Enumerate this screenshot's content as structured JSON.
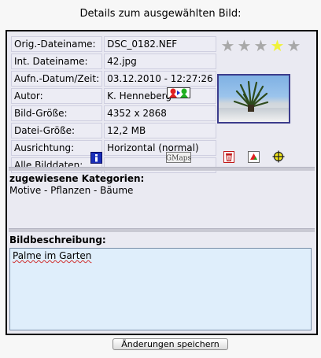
{
  "header": {
    "title": "Details zum ausgewählten Bild:"
  },
  "details": {
    "rows": [
      {
        "label": "Orig.-Dateiname:",
        "value": "DSC_0182.NEF"
      },
      {
        "label": "Int. Dateiname:",
        "value": "42.jpg"
      },
      {
        "label": "Aufn.-Datum/Zeit:",
        "value": "03.12.2010 - 12:27:26"
      },
      {
        "label": "Autor:",
        "value": "K. Henneberg"
      },
      {
        "label": "Bild-Größe:",
        "value": "4352 x 2868"
      },
      {
        "label": "Datei-Größe:",
        "value": "12,2 MB"
      },
      {
        "label": "Ausrichtung:",
        "value": "Horizontal (normal)"
      },
      {
        "label": "Alle Bilddaten:",
        "value": ""
      }
    ],
    "gmaps_label": "GMaps"
  },
  "rating": {
    "value": 4,
    "max": 5
  },
  "categories": {
    "title": "zugewiesene Kategorien:",
    "text": "Motive - Pflanzen - Bäume"
  },
  "description": {
    "title": "Bildbeschreibung:",
    "text": "Palme im Garten"
  },
  "footer": {
    "save_label": "Änderungen speichern"
  },
  "colors": {
    "star_on": "#f0f23a",
    "star_off": "#a8a8a8",
    "panel_bg": "#eaeaf2",
    "textarea_bg": "#dfeefb"
  },
  "icons": [
    "author-edit-icon",
    "info-icon",
    "gmaps-icon",
    "delete-icon",
    "rotate-icon",
    "crosshair-icon"
  ]
}
